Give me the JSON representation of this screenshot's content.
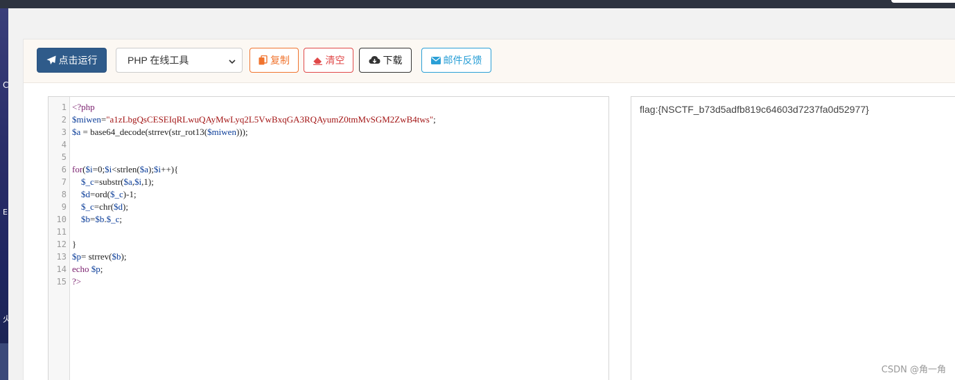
{
  "toolbar": {
    "run_label": "点击运行",
    "tool_select_value": "PHP 在线工具",
    "copy_label": "复制",
    "clear_label": "清空",
    "download_label": "下载",
    "feedback_label": "邮件反馈"
  },
  "editor": {
    "line_numbers": [
      "1",
      "2",
      "3",
      "4",
      "5",
      "6",
      "7",
      "8",
      "9",
      "10",
      "11",
      "12",
      "13",
      "14",
      "15"
    ],
    "lines": [
      [
        {
          "t": "<?php",
          "c": "kw"
        }
      ],
      [
        {
          "t": "$miwen",
          "c": "var"
        },
        {
          "t": "=",
          "c": "fn"
        },
        {
          "t": "\"a1zLbgQsCESEIqRLwuQAyMwLyq2L5VwBxqGA3RQAyumZ0tmMvSGM2ZwB4tws\"",
          "c": "str"
        },
        {
          "t": ";",
          "c": "fn"
        }
      ],
      [
        {
          "t": "$a",
          "c": "var"
        },
        {
          "t": " = base64_decode(strrev(str_rot13(",
          "c": "fn"
        },
        {
          "t": "$miwen",
          "c": "var"
        },
        {
          "t": ")));",
          "c": "fn"
        }
      ],
      [],
      [],
      [
        {
          "t": "for",
          "c": "kw"
        },
        {
          "t": "(",
          "c": "fn"
        },
        {
          "t": "$i",
          "c": "var"
        },
        {
          "t": "=0;",
          "c": "fn"
        },
        {
          "t": "$i",
          "c": "var"
        },
        {
          "t": "<strlen(",
          "c": "fn"
        },
        {
          "t": "$a",
          "c": "var"
        },
        {
          "t": ");",
          "c": "fn"
        },
        {
          "t": "$i",
          "c": "var"
        },
        {
          "t": "++){",
          "c": "fn"
        }
      ],
      [
        {
          "t": "    ",
          "c": "fn"
        },
        {
          "t": "$_c",
          "c": "var"
        },
        {
          "t": "=substr(",
          "c": "fn"
        },
        {
          "t": "$a",
          "c": "var"
        },
        {
          "t": ",",
          "c": "fn"
        },
        {
          "t": "$i",
          "c": "var"
        },
        {
          "t": ",1);",
          "c": "fn"
        }
      ],
      [
        {
          "t": "    ",
          "c": "fn"
        },
        {
          "t": "$d",
          "c": "var"
        },
        {
          "t": "=ord(",
          "c": "fn"
        },
        {
          "t": "$_c",
          "c": "var"
        },
        {
          "t": ")-1;",
          "c": "fn"
        }
      ],
      [
        {
          "t": "    ",
          "c": "fn"
        },
        {
          "t": "$_c",
          "c": "var"
        },
        {
          "t": "=chr(",
          "c": "fn"
        },
        {
          "t": "$d",
          "c": "var"
        },
        {
          "t": ");",
          "c": "fn"
        }
      ],
      [
        {
          "t": "    ",
          "c": "fn"
        },
        {
          "t": "$b",
          "c": "var"
        },
        {
          "t": "=",
          "c": "fn"
        },
        {
          "t": "$b",
          "c": "var"
        },
        {
          "t": ".",
          "c": "fn"
        },
        {
          "t": "$_c",
          "c": "var"
        },
        {
          "t": ";",
          "c": "fn"
        }
      ],
      [],
      [
        {
          "t": "}",
          "c": "fn"
        }
      ],
      [
        {
          "t": "$p",
          "c": "var"
        },
        {
          "t": "= strrev(",
          "c": "fn"
        },
        {
          "t": "$b",
          "c": "var"
        },
        {
          "t": ");",
          "c": "fn"
        }
      ],
      [
        {
          "t": "echo ",
          "c": "kw"
        },
        {
          "t": "$p",
          "c": "var"
        },
        {
          "t": ";",
          "c": "fn"
        }
      ],
      [
        {
          "t": "?>",
          "c": "kw"
        }
      ]
    ]
  },
  "output": {
    "text": "flag:{NSCTF_b73d5adfb819c64603d7237fa0d52977}"
  },
  "watermark": "CSDN @角一角",
  "desktop_fragments": [
    "C",
    "E",
    "火"
  ],
  "icons": {
    "run": "paper-plane-icon",
    "copy": "copy-icon",
    "clear": "eraser-icon",
    "download": "cloud-download-icon",
    "feedback": "envelope-icon",
    "select": "chevron-down-icon"
  },
  "colors": {
    "run_bg": "#2f5b8a",
    "copy": "#f0742f",
    "clear": "#e04848",
    "download": "#333333",
    "feedback": "#2a9fd6"
  }
}
